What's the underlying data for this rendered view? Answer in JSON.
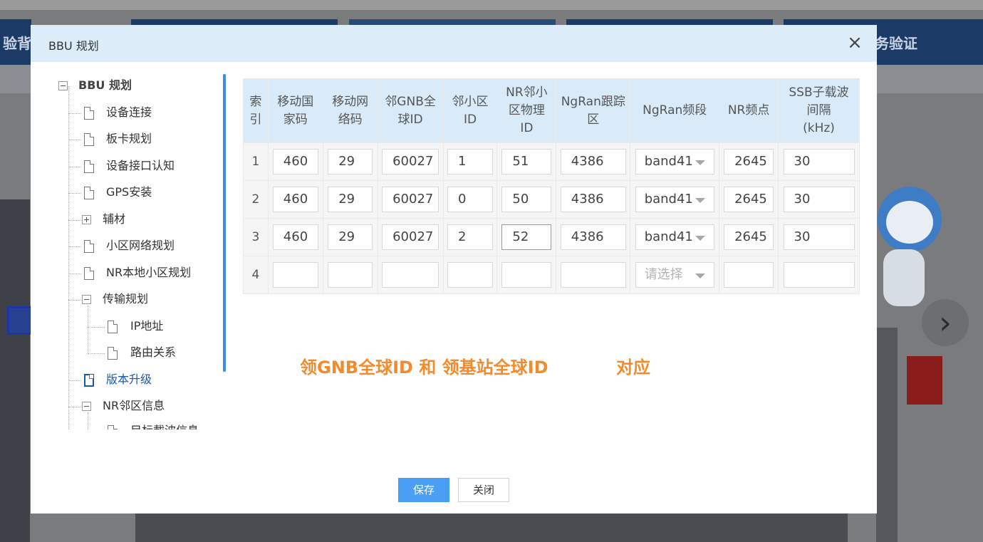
{
  "background": {
    "nav_left_text": "验背",
    "nav_right_text": "务验证",
    "next_arrow": "›"
  },
  "modal": {
    "title": "BBU 规划",
    "close_symbol": "×"
  },
  "tree": {
    "root": "BBU 规划",
    "items": [
      {
        "label": "设备连接",
        "type": "file"
      },
      {
        "label": "板卡规划",
        "type": "file"
      },
      {
        "label": "设备接口认知",
        "type": "file"
      },
      {
        "label": "GPS安装",
        "type": "file"
      },
      {
        "label": "辅材",
        "type": "folder-collapsed"
      },
      {
        "label": "小区网络规划",
        "type": "file"
      },
      {
        "label": "NR本地小区规划",
        "type": "file"
      },
      {
        "label": "传输规划",
        "type": "folder-expanded"
      },
      {
        "label": "IP地址",
        "type": "file"
      },
      {
        "label": "路由关系",
        "type": "file"
      },
      {
        "label": "版本升级",
        "type": "file",
        "active": true
      },
      {
        "label": "NR邻区信息",
        "type": "folder-expanded"
      },
      {
        "label": "目标載波信息",
        "type": "file"
      }
    ]
  },
  "table": {
    "headers": [
      [
        "索",
        "引"
      ],
      [
        "移动国",
        "家码"
      ],
      [
        "移动网",
        "络码"
      ],
      [
        "邻GNB全",
        "球ID"
      ],
      [
        "邻小区",
        "ID"
      ],
      [
        "NR邻小",
        "区物理",
        "ID"
      ],
      [
        "NgRan跟踪",
        "区"
      ],
      [
        "NgRan频段"
      ],
      [
        "NR频点"
      ],
      [
        "SSB子载波",
        "间隔",
        "(kHz)"
      ]
    ],
    "rows": [
      {
        "index": "1",
        "mcc": "460",
        "mnc": "29",
        "gnb_id": "60027",
        "cell_id": "1",
        "pci": "51",
        "tac": "4386",
        "band": "band41",
        "arfcn": "2645",
        "scs": "30"
      },
      {
        "index": "2",
        "mcc": "460",
        "mnc": "29",
        "gnb_id": "60027",
        "cell_id": "0",
        "pci": "50",
        "tac": "4386",
        "band": "band41",
        "arfcn": "2645",
        "scs": "30"
      },
      {
        "index": "3",
        "mcc": "460",
        "mnc": "29",
        "gnb_id": "60027",
        "cell_id": "2",
        "pci": "52",
        "tac": "4386",
        "band": "band41",
        "arfcn": "2645",
        "scs": "30"
      },
      {
        "index": "4",
        "mcc": "",
        "mnc": "",
        "gnb_id": "",
        "cell_id": "",
        "pci": "",
        "tac": "",
        "band": "",
        "arfcn": "",
        "scs": ""
      }
    ],
    "select_placeholder": "请选择"
  },
  "note": {
    "left": "领GNB全球ID 和 领基站全球ID",
    "right": "对应"
  },
  "footer": {
    "save_label": "保存",
    "close_label": "关闭"
  },
  "colors": {
    "header_bg": "#dcedf9",
    "accent": "#4a9ff4",
    "note": "#f38b2c",
    "active_tree": "#1d57a8"
  }
}
